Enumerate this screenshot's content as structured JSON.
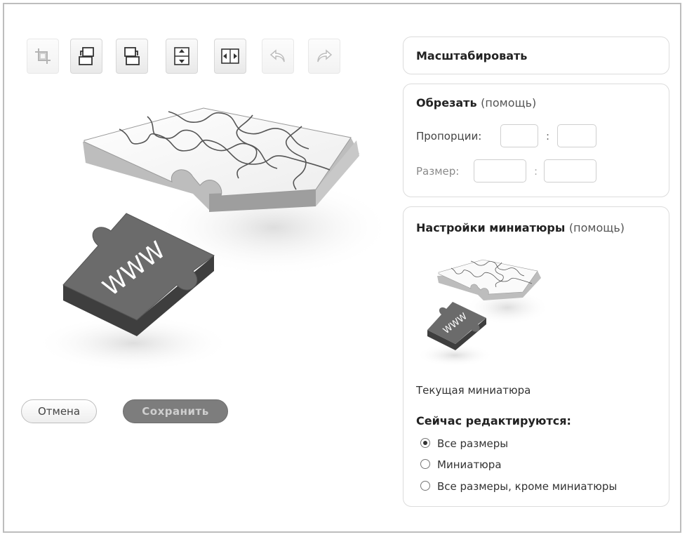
{
  "toolbar": {
    "buttons": [
      {
        "name": "crop-icon",
        "disabled": true
      },
      {
        "name": "rotate-left-icon",
        "disabled": false
      },
      {
        "name": "rotate-right-icon",
        "disabled": false
      },
      {
        "name": "flip-vertical-icon",
        "disabled": false
      },
      {
        "name": "flip-horizontal-icon",
        "disabled": false
      },
      {
        "name": "undo-icon",
        "disabled": true
      },
      {
        "name": "redo-icon",
        "disabled": true
      }
    ]
  },
  "image": {
    "text": "WWW"
  },
  "actions": {
    "cancel": "Отмена",
    "save": "Сохранить"
  },
  "scale": {
    "title": "Масштабировать"
  },
  "crop": {
    "title": "Обрезать",
    "help": "(помощь)",
    "ratio_label": "Пропорции:",
    "size_label": "Размер:",
    "separator": ":",
    "ratio_w": "",
    "ratio_h": "",
    "size_w": "",
    "size_h": ""
  },
  "thumb": {
    "title": "Настройки миниатюры",
    "help": "(помощь)",
    "current_label": "Текущая миниатюра",
    "editing_title": "Сейчас редактируются:",
    "options": [
      {
        "label": "Все размеры",
        "checked": true
      },
      {
        "label": "Миниатюра",
        "checked": false
      },
      {
        "label": "Все размеры, кроме миниатюры",
        "checked": false
      }
    ]
  }
}
